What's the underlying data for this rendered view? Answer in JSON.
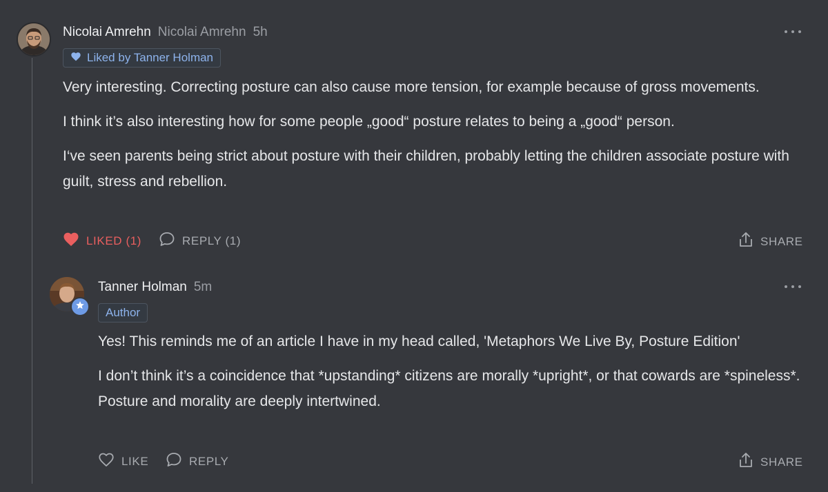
{
  "comment": {
    "author": "Nicolai Amrehn",
    "handle": "Nicolai Amrehn",
    "time": "5h",
    "liked_by": "Liked by Tanner Holman",
    "paragraphs": [
      "Very interesting. Correcting posture can also cause more tension, for example because of gross movements.",
      "I think it’s also interesting how for some people „good“ posture relates to being a „good“ person.",
      "I‘ve seen parents being strict about posture with their children, probably letting the children associate posture with guilt, stress and rebellion."
    ],
    "actions": {
      "like_label": "LIKED (1)",
      "reply_label": "REPLY (1)",
      "share_label": "SHARE"
    }
  },
  "reply": {
    "author": "Tanner Holman",
    "time": "5m",
    "badge": "Author",
    "paragraphs": [
      "Yes! This reminds me of an article I have in my head called, 'Metaphors We Live By, Posture Edition'",
      "I don’t think it’s a coincidence that *upstanding* citizens are morally *upright*, or that cowards are *spineless*. Posture and morality are deeply intertwined."
    ],
    "actions": {
      "like_label": "LIKE",
      "reply_label": "REPLY",
      "share_label": "SHARE"
    }
  },
  "colors": {
    "background": "#36383d",
    "liked": "#ea5f5f",
    "accent_blue": "#8db3ec",
    "muted": "#a8abb0"
  }
}
